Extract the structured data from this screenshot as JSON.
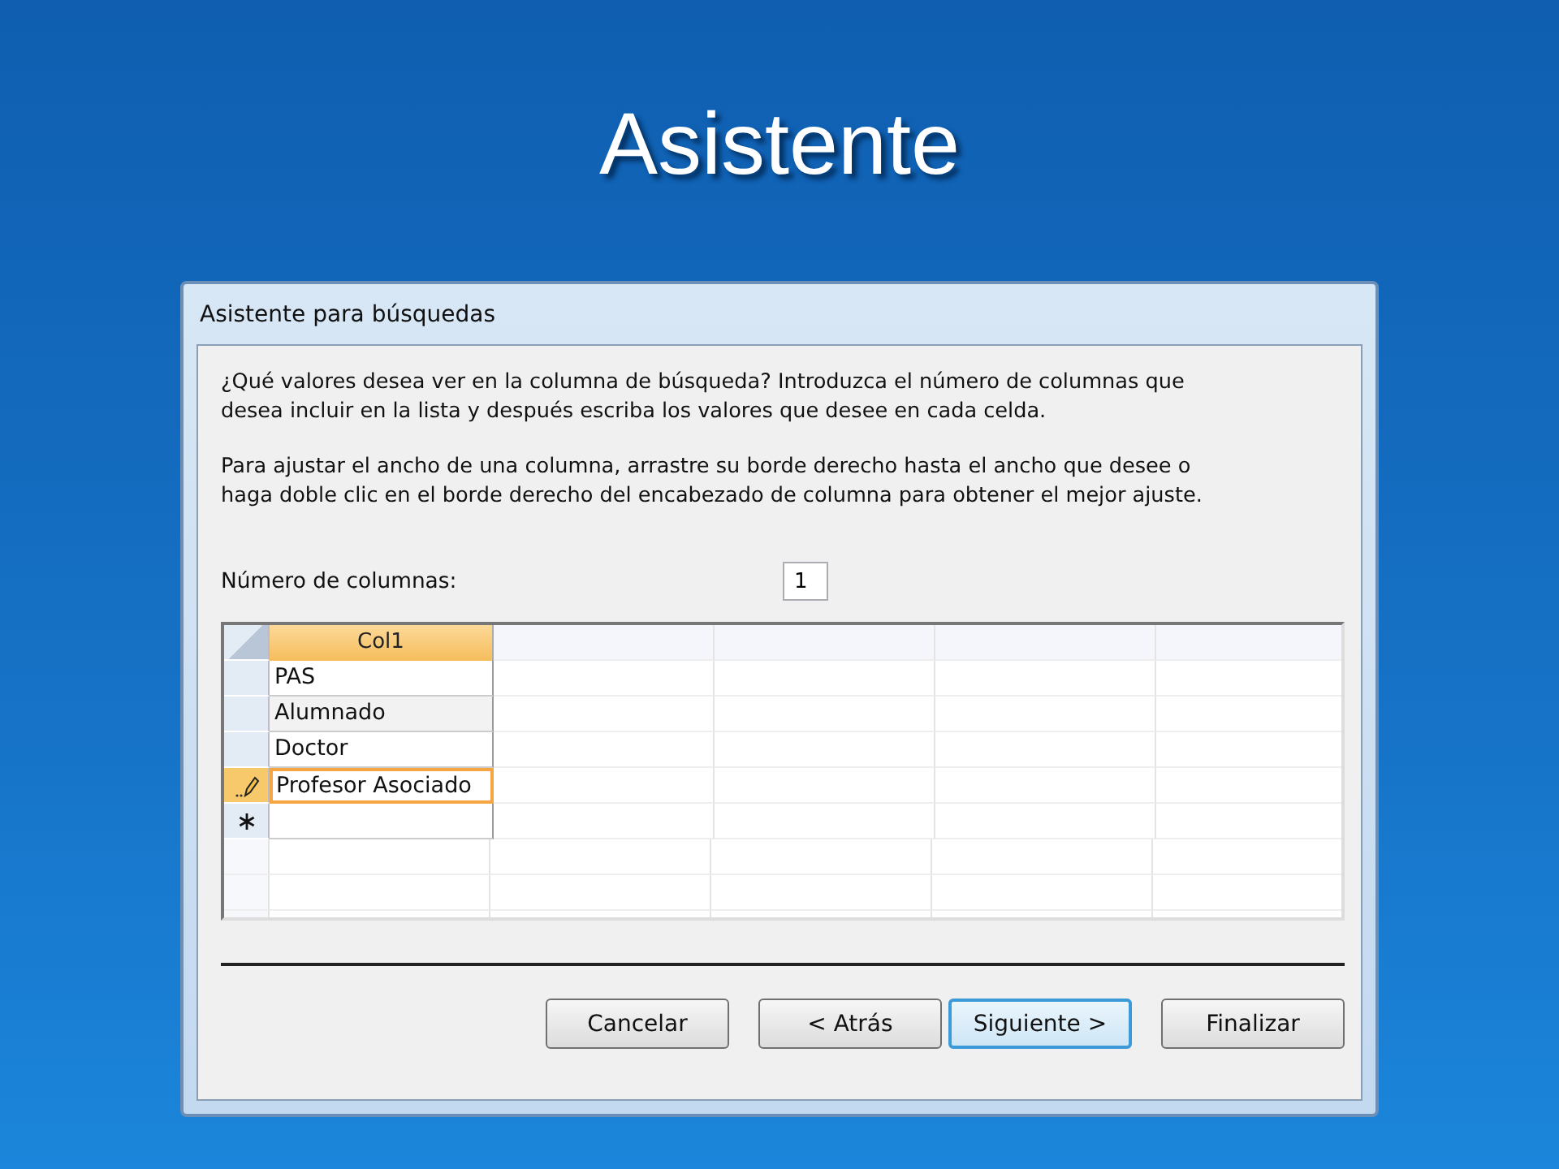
{
  "slide_title": "Asistente",
  "window": {
    "title": "Asistente para búsquedas"
  },
  "instructions": [
    "¿Qué valores desea ver en la columna de búsqueda? Introduzca el número de columnas que desea incluir en la lista y después escriba los valores que desee en cada celda.",
    "Para ajustar el ancho de una columna, arrastre su borde derecho hasta el ancho que desee o haga doble clic en el borde derecho del encabezado de columna para obtener el mejor ajuste."
  ],
  "column_count": {
    "label": "Número de columnas:",
    "value": "1"
  },
  "grid": {
    "columns": [
      "Col1"
    ],
    "rows": [
      {
        "kind": "data",
        "cells": [
          "PAS"
        ],
        "selected": false
      },
      {
        "kind": "data",
        "cells": [
          "Alumnado"
        ],
        "selected": false
      },
      {
        "kind": "data",
        "cells": [
          "Doctor"
        ],
        "selected": false
      },
      {
        "kind": "editing",
        "cells": [
          "Profesor Asociado"
        ],
        "selected": true
      },
      {
        "kind": "new",
        "cells": [
          ""
        ],
        "selected": false
      }
    ]
  },
  "buttons": [
    {
      "label": "Cancelar",
      "default": false
    },
    {
      "label": "< Atrás",
      "default": false
    },
    {
      "label": "Siguiente >",
      "default": true
    },
    {
      "label": "Finalizar",
      "default": false
    }
  ]
}
